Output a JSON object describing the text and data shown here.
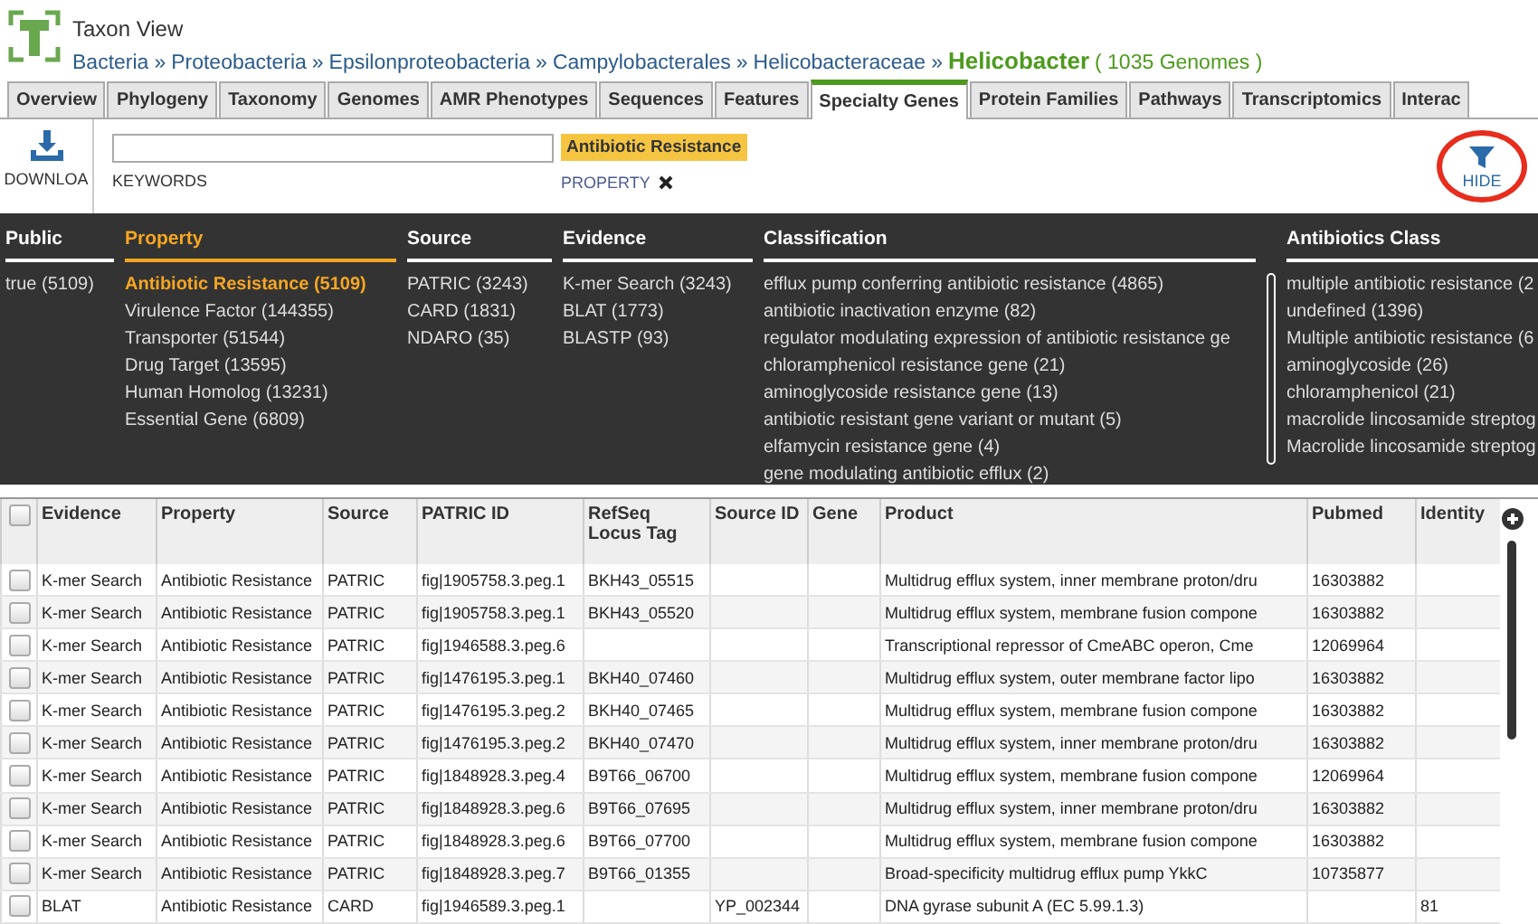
{
  "header": {
    "title": "Taxon View",
    "breadcrumb": [
      "Bacteria",
      "Proteobacteria",
      "Epsilonproteobacteria",
      "Campylobacterales",
      "Helicobacteraceae"
    ],
    "separator": "»",
    "current": "Helicobacter",
    "genome_count": "( 1035 Genomes )"
  },
  "tabs": [
    {
      "label": "Overview",
      "selected": false
    },
    {
      "label": "Phylogeny",
      "selected": false
    },
    {
      "label": "Taxonomy",
      "selected": false
    },
    {
      "label": "Genomes",
      "selected": false
    },
    {
      "label": "AMR Phenotypes",
      "selected": false
    },
    {
      "label": "Sequences",
      "selected": false
    },
    {
      "label": "Features",
      "selected": false
    },
    {
      "label": "Specialty Genes",
      "selected": true
    },
    {
      "label": "Protein Families",
      "selected": false
    },
    {
      "label": "Pathways",
      "selected": false
    },
    {
      "label": "Transcriptomics",
      "selected": false
    },
    {
      "label": "Interac",
      "selected": false
    }
  ],
  "toolbar": {
    "download_label": "DOWNLOA",
    "keywords_label": "KEYWORDS",
    "filter_tag": "Antibiotic Resistance",
    "filter_field": "PROPERTY",
    "hide_label": "HIDE"
  },
  "facets": [
    {
      "title": "Public",
      "selected": false,
      "values": [
        {
          "label": "true (5109)",
          "selected": false
        }
      ]
    },
    {
      "title": "Property",
      "selected": true,
      "values": [
        {
          "label": "Antibiotic Resistance (5109)",
          "selected": true
        },
        {
          "label": "Virulence Factor (144355)",
          "selected": false
        },
        {
          "label": "Transporter (51544)",
          "selected": false
        },
        {
          "label": "Drug Target (13595)",
          "selected": false
        },
        {
          "label": "Human Homolog (13231)",
          "selected": false
        },
        {
          "label": "Essential Gene (6809)",
          "selected": false
        }
      ]
    },
    {
      "title": "Source",
      "selected": false,
      "values": [
        {
          "label": "PATRIC (3243)",
          "selected": false
        },
        {
          "label": "CARD (1831)",
          "selected": false
        },
        {
          "label": "NDARO (35)",
          "selected": false
        }
      ]
    },
    {
      "title": "Evidence",
      "selected": false,
      "values": [
        {
          "label": "K-mer Search (3243)",
          "selected": false
        },
        {
          "label": "BLAT (1773)",
          "selected": false
        },
        {
          "label": "BLASTP (93)",
          "selected": false
        }
      ]
    },
    {
      "title": "Classification",
      "selected": false,
      "values": [
        {
          "label": "efflux pump conferring antibiotic resistance (4865)",
          "selected": false
        },
        {
          "label": "antibiotic inactivation enzyme (82)",
          "selected": false
        },
        {
          "label": "regulator modulating expression of antibiotic resistance ge",
          "selected": false
        },
        {
          "label": "chloramphenicol resistance gene (21)",
          "selected": false
        },
        {
          "label": "aminoglycoside resistance gene (13)",
          "selected": false
        },
        {
          "label": "antibiotic resistant gene variant or mutant (5)",
          "selected": false
        },
        {
          "label": "elfamycin resistance gene (4)",
          "selected": false
        },
        {
          "label": "gene modulating antibiotic efflux (2)",
          "selected": false
        }
      ]
    },
    {
      "title": "Antibiotics Class",
      "selected": false,
      "values": [
        {
          "label": "multiple antibiotic resistance (2",
          "selected": false
        },
        {
          "label": "undefined (1396)",
          "selected": false
        },
        {
          "label": "Multiple antibiotic resistance (6",
          "selected": false
        },
        {
          "label": "aminoglycoside (26)",
          "selected": false
        },
        {
          "label": "chloramphenicol (21)",
          "selected": false
        },
        {
          "label": "macrolide lincosamide streptog",
          "selected": false
        },
        {
          "label": "Macrolide lincosamide streptog",
          "selected": false
        }
      ]
    }
  ],
  "table": {
    "all_checked": false,
    "columns": [
      "Evidence",
      "Property",
      "Source",
      "PATRIC ID",
      "RefSeq Locus Tag",
      "Source ID",
      "Gene",
      "Product",
      "Pubmed",
      "Identity"
    ],
    "rows": [
      {
        "checked": false,
        "cells": [
          "K-mer Search",
          "Antibiotic Resistance",
          "PATRIC",
          "fig|1905758.3.peg.1",
          "BKH43_05515",
          "",
          "",
          "Multidrug efflux system, inner membrane proton/dru",
          "16303882",
          ""
        ]
      },
      {
        "checked": false,
        "cells": [
          "K-mer Search",
          "Antibiotic Resistance",
          "PATRIC",
          "fig|1905758.3.peg.1",
          "BKH43_05520",
          "",
          "",
          "Multidrug efflux system, membrane fusion compone",
          "16303882",
          ""
        ]
      },
      {
        "checked": false,
        "cells": [
          "K-mer Search",
          "Antibiotic Resistance",
          "PATRIC",
          "fig|1946588.3.peg.6",
          "",
          "",
          "",
          "Transcriptional repressor of CmeABC operon, Cme",
          "12069964",
          ""
        ]
      },
      {
        "checked": false,
        "cells": [
          "K-mer Search",
          "Antibiotic Resistance",
          "PATRIC",
          "fig|1476195.3.peg.1",
          "BKH40_07460",
          "",
          "",
          "Multidrug efflux system, outer membrane factor lipo",
          "16303882",
          ""
        ]
      },
      {
        "checked": false,
        "cells": [
          "K-mer Search",
          "Antibiotic Resistance",
          "PATRIC",
          "fig|1476195.3.peg.2",
          "BKH40_07465",
          "",
          "",
          "Multidrug efflux system, membrane fusion compone",
          "16303882",
          ""
        ]
      },
      {
        "checked": false,
        "cells": [
          "K-mer Search",
          "Antibiotic Resistance",
          "PATRIC",
          "fig|1476195.3.peg.2",
          "BKH40_07470",
          "",
          "",
          "Multidrug efflux system, inner membrane proton/dru",
          "16303882",
          ""
        ]
      },
      {
        "checked": false,
        "cells": [
          "K-mer Search",
          "Antibiotic Resistance",
          "PATRIC",
          "fig|1848928.3.peg.4",
          "B9T66_06700",
          "",
          "",
          "Multidrug efflux system, membrane fusion compone",
          "12069964",
          ""
        ]
      },
      {
        "checked": false,
        "cells": [
          "K-mer Search",
          "Antibiotic Resistance",
          "PATRIC",
          "fig|1848928.3.peg.6",
          "B9T66_07695",
          "",
          "",
          "Multidrug efflux system, inner membrane proton/dru",
          "16303882",
          ""
        ]
      },
      {
        "checked": false,
        "cells": [
          "K-mer Search",
          "Antibiotic Resistance",
          "PATRIC",
          "fig|1848928.3.peg.6",
          "B9T66_07700",
          "",
          "",
          "Multidrug efflux system, membrane fusion compone",
          "16303882",
          ""
        ]
      },
      {
        "checked": false,
        "cells": [
          "K-mer Search",
          "Antibiotic Resistance",
          "PATRIC",
          "fig|1848928.3.peg.7",
          "B9T66_01355",
          "",
          "",
          "Broad-specificity multidrug efflux pump YkkC",
          "10735877",
          ""
        ]
      },
      {
        "checked": false,
        "cells": [
          "BLAT",
          "Antibiotic Resistance",
          "CARD",
          "fig|1946589.3.peg.1",
          "",
          "YP_002344",
          "",
          "DNA gyrase subunit A (EC 5.99.1.3)",
          "",
          "81"
        ]
      }
    ]
  }
}
